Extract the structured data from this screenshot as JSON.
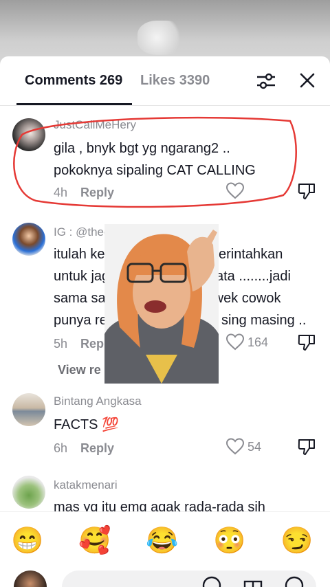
{
  "tabs": {
    "comments_label": "Comments 269",
    "likes_label": "Likes 3390"
  },
  "comments": [
    {
      "username": "JustCallMeHery",
      "text_line1": "gila , bnyk bgt yg ngarang2 ..",
      "text_line2": "pokoknya sipaling CAT CALLING",
      "time": "4h",
      "reply": "Reply",
      "likes": ""
    },
    {
      "username": "IG : @thecharis",
      "text_line1": "itulah kena",
      "text_line1b": "erintahkan",
      "text_line2": "untuk jaga",
      "text_line2b": "ata ........jadi",
      "text_line3": "sama sam",
      "text_line3b": "ce wek cowok",
      "text_line4": "punya re",
      "text_line4b": "sing masing ..",
      "time": "5h",
      "reply": "Repl",
      "likes": "164",
      "view_replies": "View re"
    },
    {
      "username": "Bintang Angkasa",
      "text": "FACTS 💯",
      "time": "6h",
      "reply": "Reply",
      "likes": "54"
    },
    {
      "username": "katakmenari",
      "text": "mas yg itu emg agak rada-rada sih"
    }
  ],
  "emojis": [
    "😁",
    "🥰",
    "😂",
    "😳",
    "😏"
  ],
  "colors": {
    "annotation_red": "#e53935",
    "muted_text": "#8a8b91",
    "primary_text": "#161823"
  }
}
